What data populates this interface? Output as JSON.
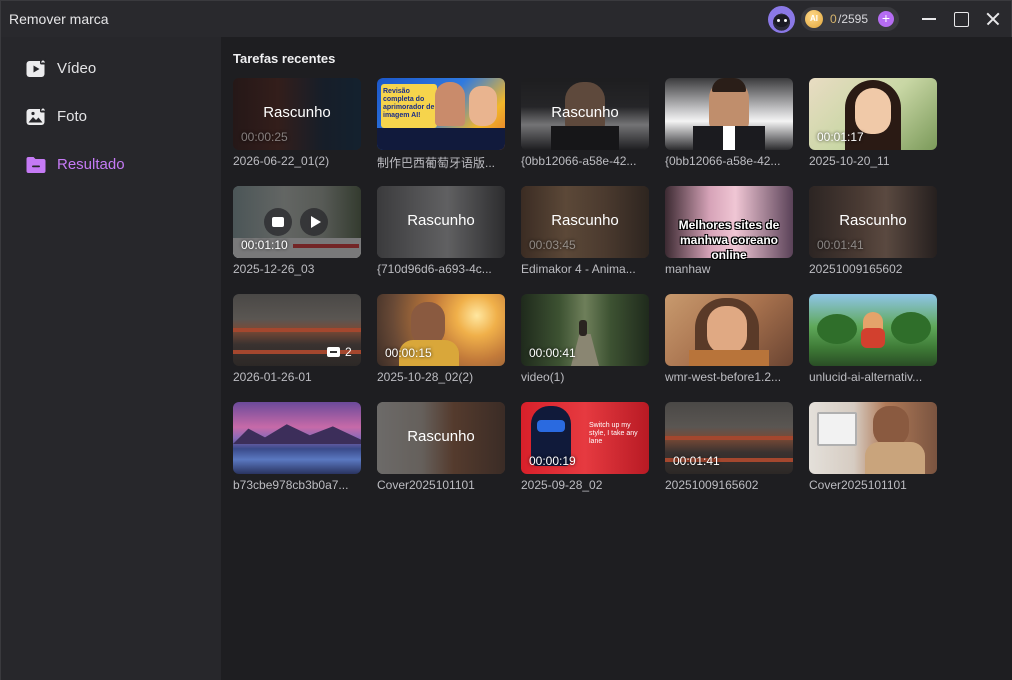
{
  "titlebar": {
    "title": "Remover marca",
    "credits_used": "0",
    "credits_total": "/2595",
    "coin_label": "AI"
  },
  "sidebar": {
    "items": [
      {
        "label": "Vídeo",
        "icon": "video-icon"
      },
      {
        "label": "Foto",
        "icon": "photo-icon"
      },
      {
        "label": "Resultado",
        "icon": "folder-icon",
        "active": true
      }
    ]
  },
  "main": {
    "section_title": "Tarefas recentes",
    "draft_label": "Rascunho",
    "cards": [
      {
        "caption": "2026-06-22_01(2)",
        "duration": "00:00:25",
        "draft": true
      },
      {
        "caption": "制作巴西葡萄牙语版...",
        "thumb_text": "Revisão completa do aprimorador de imagem AI!"
      },
      {
        "caption": "{0bb12066-a58e-42...",
        "draft": true
      },
      {
        "caption": "{0bb12066-a58e-42..."
      },
      {
        "caption": "2025-10-20_11",
        "duration": "00:01:17"
      },
      {
        "caption": "2025-12-26_03",
        "duration": "00:01:10",
        "hover": true
      },
      {
        "caption": "{710d96d6-a693-4c...",
        "draft": true
      },
      {
        "caption": "Edimakor 4 - Anima...",
        "duration": "00:03:45",
        "draft": true
      },
      {
        "caption": "manhaw",
        "overlay": "Melhores sites de manhwa coreano online"
      },
      {
        "caption": "20251009165602",
        "duration": "00:01:41",
        "draft": true
      },
      {
        "caption": "2026-01-26-01",
        "count": "2"
      },
      {
        "caption": "2025-10-28_02(2)",
        "duration": "00:00:15"
      },
      {
        "caption": "video(1)",
        "duration": "00:00:41"
      },
      {
        "caption": "wmr-west-before1.2..."
      },
      {
        "caption": "unlucid-ai-alternativ..."
      },
      {
        "caption": "b73cbe978cb3b0a7..."
      },
      {
        "caption": "Cover2025101101",
        "draft": true
      },
      {
        "caption": "2025-09-28_02",
        "duration": "00:00:19",
        "thumb_text": "Switch up my style, I take any lane"
      },
      {
        "caption": "20251009165602",
        "duration": "00:01:41"
      },
      {
        "caption": "Cover2025101101"
      }
    ]
  },
  "colors": {
    "accent": "#c57af5",
    "background": "#1e1e21",
    "sidebar": "#27272b",
    "titlebar": "#29292d"
  }
}
